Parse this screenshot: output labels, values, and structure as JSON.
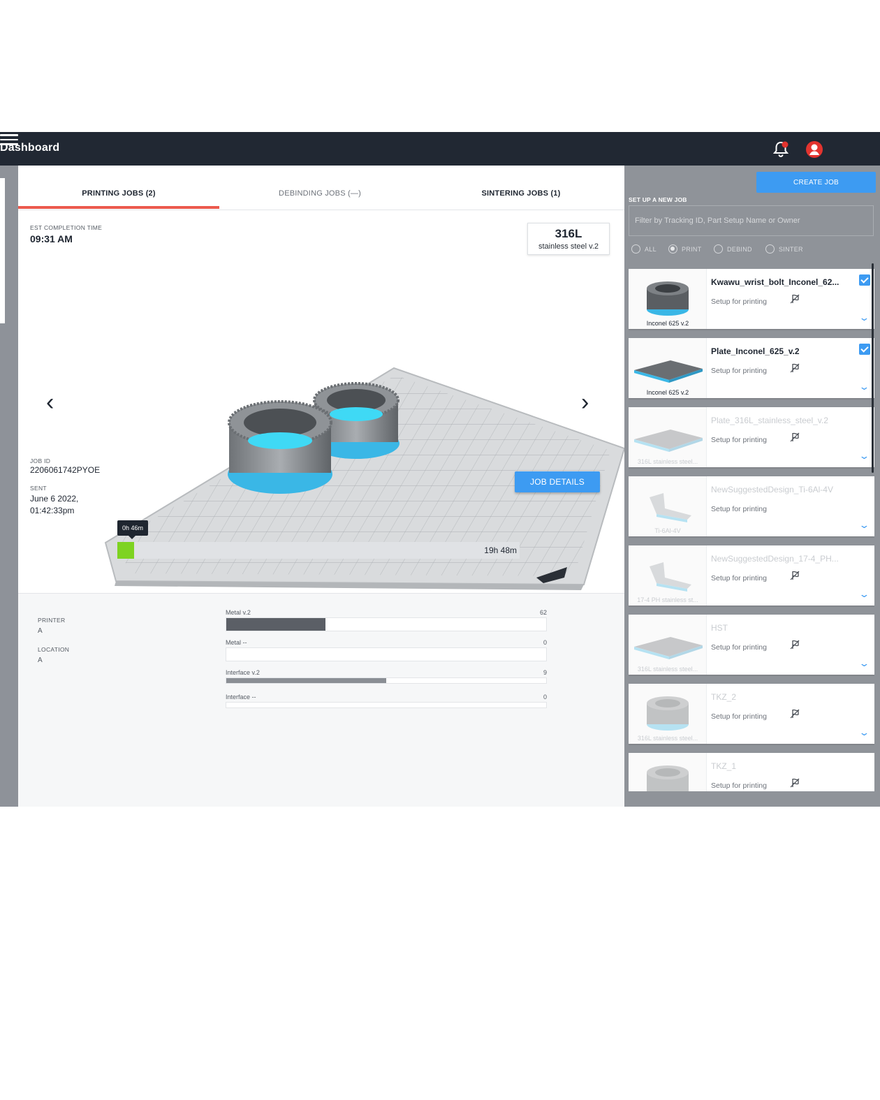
{
  "header": {
    "title": "Dashboard"
  },
  "tabs": [
    {
      "label": "PRINTING JOBS (2)"
    },
    {
      "label": "DEBINDING JOBS (—)"
    },
    {
      "label": "SINTERING JOBS (1)"
    }
  ],
  "job": {
    "est_label": "EST COMPLETION TIME",
    "est_value": "09:31 AM",
    "material_code": "316L",
    "material_name": "stainless steel v.2",
    "job_id_label": "JOB ID",
    "job_id": "2206061742PYOE",
    "sent_label": "SENT",
    "sent_value": "June 6 2022, 01:42:33pm",
    "details_button": "JOB DETAILS",
    "progress_elapsed": "0h 46m",
    "progress_total": "19h 48m",
    "progress_fraction": 0.04
  },
  "details": {
    "printer_label": "PRINTER",
    "printer_value": "A",
    "location_label": "LOCATION",
    "location_value": "A",
    "cartridges": [
      {
        "name": "Metal v.2",
        "value": "62",
        "fill": 0.31
      },
      {
        "name": "Metal --",
        "value": "0",
        "fill": 0
      },
      {
        "name": "Interface v.2",
        "value": "9",
        "fill": 0.5
      },
      {
        "name": "Interface --",
        "value": "0",
        "fill": 0
      }
    ]
  },
  "sidebar": {
    "create_button": "CREATE JOB",
    "setup_label": "SET UP A NEW JOB",
    "filter_placeholder": "Filter by Tracking ID, Part Setup Name or Owner",
    "filters": [
      {
        "label": "ALL",
        "selected": false
      },
      {
        "label": "PRINT",
        "selected": true
      },
      {
        "label": "DEBIND",
        "selected": false
      },
      {
        "label": "SINTER",
        "selected": false
      }
    ],
    "jobs": [
      {
        "title": "Kwawu_wrist_bolt_Inconel_62...",
        "status": "Setup for printing",
        "material": "Inconel 625 v.2",
        "checked": true,
        "dim": false,
        "shape": "cylinder",
        "flag": true
      },
      {
        "title": "Plate_Inconel_625_v.2",
        "status": "Setup for printing",
        "material": "Inconel 625 v.2",
        "checked": true,
        "dim": false,
        "shape": "plate",
        "flag": true
      },
      {
        "title": "Plate_316L_stainless_steel_v.2",
        "status": "Setup for printing",
        "material": "316L stainless steel...",
        "checked": false,
        "dim": true,
        "shape": "plate",
        "flag": true
      },
      {
        "title": "NewSuggestedDesign_Ti-6Al-4V",
        "status": "Setup for printing",
        "material": "Ti-6Al-4V",
        "checked": false,
        "dim": true,
        "shape": "bracket",
        "flag": false
      },
      {
        "title": "NewSuggestedDesign_17-4_PH...",
        "status": "Setup for printing",
        "material": "17-4 PH stainless st...",
        "checked": false,
        "dim": true,
        "shape": "bracket",
        "flag": true
      },
      {
        "title": "HST",
        "status": "Setup for printing",
        "material": "316L stainless steel...",
        "checked": false,
        "dim": true,
        "shape": "plate",
        "flag": true
      },
      {
        "title": "TKZ_2",
        "status": "Setup for printing",
        "material": "316L stainless steel...",
        "checked": false,
        "dim": true,
        "shape": "cylinder",
        "flag": true
      },
      {
        "title": "TKZ_1",
        "status": "Setup for printing",
        "material": "",
        "checked": false,
        "dim": true,
        "shape": "cylinder",
        "flag": true
      }
    ]
  },
  "colors": {
    "accent": "#3d9bf2",
    "tab_active": "#ec5a4e",
    "progress": "#7ed321",
    "header": "#212833"
  }
}
